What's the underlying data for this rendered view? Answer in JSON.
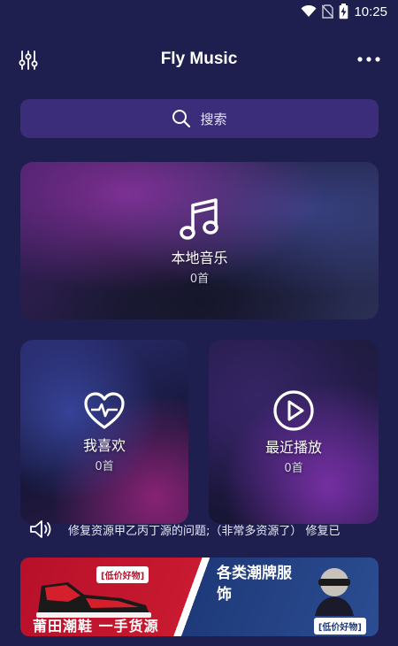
{
  "status_bar": {
    "time": "10:25",
    "icons": [
      "wifi-icon",
      "no-sim-icon",
      "battery-charging-icon"
    ]
  },
  "header": {
    "title": "Fly Music",
    "left_icon": "equalizer-icon",
    "right_icon": "more-dots-icon"
  },
  "search": {
    "placeholder": "搜索",
    "icon": "search-icon"
  },
  "cards": {
    "local": {
      "label": "本地音乐",
      "count": "0首",
      "icon": "music-note-icon"
    },
    "favorites": {
      "label": "我喜欢",
      "count": "0首",
      "icon": "heart-pulse-icon"
    },
    "recent": {
      "label": "最近播放",
      "count": "0首",
      "icon": "play-circle-icon"
    }
  },
  "notice": {
    "icon": "speaker-icon",
    "text": "修复资源甲乙丙丁源的问题;（非常多资源了） 修复已"
  },
  "ad": {
    "tag_left": "[低价好物]",
    "title_left": "莆田潮鞋 一手货源",
    "title_right": "各类潮牌服饰",
    "tag_right": "[低价好物]",
    "colors": {
      "red": "#c81a30",
      "blue": "#1e3a7a"
    }
  },
  "theme": {
    "background": "#1e1f4f",
    "search_bg": "#3b2d7a"
  }
}
